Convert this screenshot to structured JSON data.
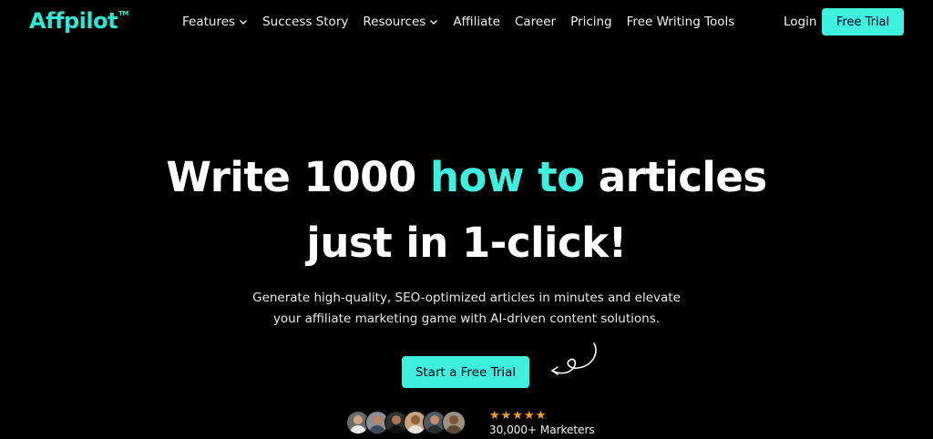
{
  "brand": {
    "name": "Affpilot",
    "tm": "TM"
  },
  "nav": {
    "items": [
      {
        "label": "Features",
        "dropdown": true
      },
      {
        "label": "Success Story",
        "dropdown": false
      },
      {
        "label": "Resources",
        "dropdown": true
      },
      {
        "label": "Affiliate",
        "dropdown": false
      },
      {
        "label": "Career",
        "dropdown": false
      },
      {
        "label": "Pricing",
        "dropdown": false
      },
      {
        "label": "Free Writing Tools",
        "dropdown": false
      }
    ],
    "login_label": "Login",
    "cta_label": "Free Trial"
  },
  "hero": {
    "line1_pre": "Write 1000 ",
    "line1_accent": "how to",
    "line1_post": " articles",
    "line2": "just in 1-click!",
    "sub_line1": "Generate high-quality, SEO-optimized articles in minutes and elevate",
    "sub_line2": "your affiliate marketing game with AI-driven content solutions.",
    "cta_label": "Start a Free Trial",
    "rating_stars": "★★★★★",
    "rating": 5,
    "marketers": "30,000+ Marketers"
  },
  "colors": {
    "background": "#000000",
    "accent": "#3ff0df",
    "star": "#ff9a1f"
  }
}
